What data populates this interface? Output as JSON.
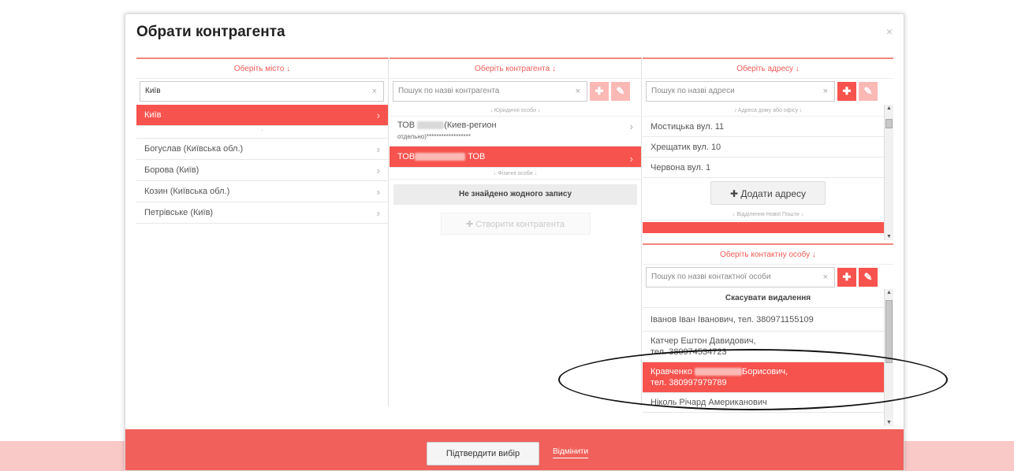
{
  "modal": {
    "title": "Обрати контрагента",
    "close": "×"
  },
  "city": {
    "header": "Оберіть місто ↓",
    "search_value": "Київ",
    "clear": "×",
    "selected": "Київ",
    "separator": "·",
    "items": [
      "Богуслав (Київська обл.)",
      "Борова (Київ)",
      "Козин (Київська обл.)",
      "Петрівське (Київ)"
    ]
  },
  "contractor": {
    "header": "Оберіть контрагента ↓",
    "search_placeholder": "Пошук по назві контрагента",
    "clear": "×",
    "legal_label": "↓ Юридичні особи ↓",
    "item1_prefix": "ТОВ",
    "item1_suffix": "(Киев-регион",
    "item1_line2": "отдельно)******************",
    "item2_prefix": "ТОВ",
    "item2_suffix": "ТОВ",
    "physical_label": "↓ Фізичні особи ↓",
    "empty": "Не знайдено жодного запису",
    "create_button": "✚ Створити контрагента"
  },
  "address": {
    "header": "Оберіть адресу ↓",
    "search_placeholder": "Пошук по назві адреси",
    "clear": "×",
    "office_label": "↓ Адреса дому або офісу ↓",
    "items": [
      "Мостицька вул. 11",
      "Хрещатик вул. 10",
      "Червона вул. 1"
    ],
    "add_button": "✚ Додати адресу",
    "nova_label": "↓ Відділення Нової Пошти ↓"
  },
  "contact": {
    "header": "Оберіть контактну особу ↓",
    "search_placeholder": "Пошук по назві контактної особи",
    "clear": "×",
    "cancel_delete": "Скасувати видалення",
    "items": [
      {
        "line1": "Іванов Іван Іванович, тел. 380971155109",
        "line2": ""
      },
      {
        "line1": "Катчер Ештон Давидович,",
        "line2": "тел. 380974534723"
      },
      {
        "line1_prefix": "Кравченко",
        "line1_suffix": "Борисович,",
        "line2": "тел. 380997979789"
      },
      {
        "line1": "Ніколь Річард Американович",
        "line2": ""
      }
    ]
  },
  "footer": {
    "confirm": "Підтвердити вибір",
    "cancel": "Відмінити"
  },
  "colors": {
    "accent": "#f7534e",
    "footer": "#f1605b",
    "strip": "#f9c9c8"
  }
}
